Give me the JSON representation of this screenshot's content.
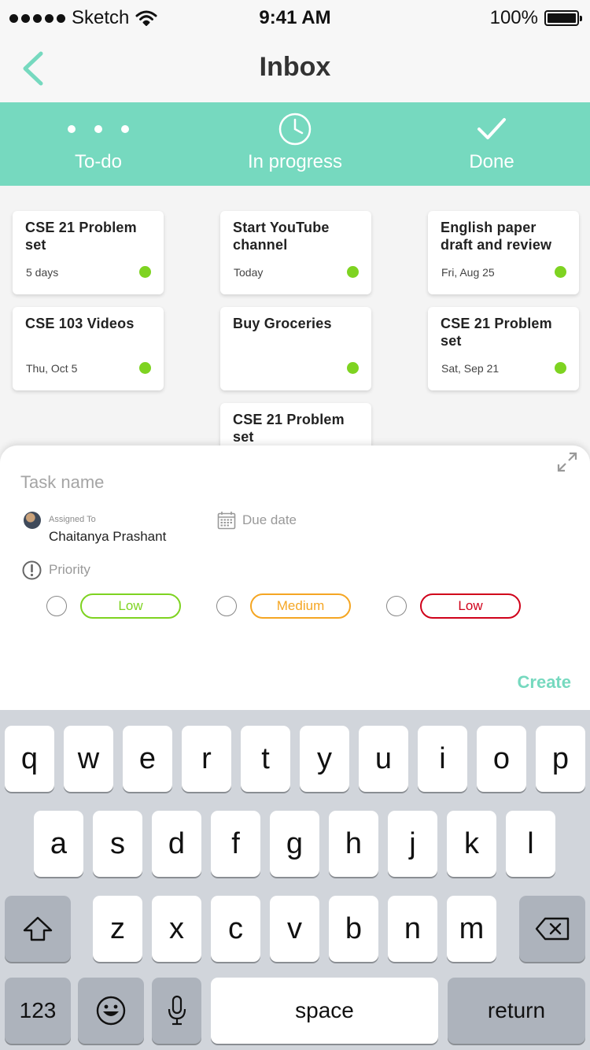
{
  "status_bar": {
    "carrier": "Sketch",
    "time": "9:41 AM",
    "battery": "100%"
  },
  "nav": {
    "title": "Inbox"
  },
  "tabs": [
    {
      "label": "To-do",
      "icon": "dots-icon"
    },
    {
      "label": "In progress",
      "icon": "clock-icon"
    },
    {
      "label": "Done",
      "icon": "checkmark-icon"
    }
  ],
  "columns": [
    {
      "cards": [
        {
          "title": "CSE 21 Problem set",
          "date": "5 days"
        },
        {
          "title": "CSE 103 Videos",
          "date": "Thu, Oct 5"
        }
      ]
    },
    {
      "cards": [
        {
          "title": "Start YouTube channel",
          "date": "Today"
        },
        {
          "title": "Buy Groceries",
          "date": ""
        },
        {
          "title": "CSE 21 Problem set",
          "date": ""
        }
      ]
    },
    {
      "cards": [
        {
          "title": "English paper draft and review",
          "date": "Fri, Aug 25"
        },
        {
          "title": "CSE 21 Problem set",
          "date": "Sat, Sep 21"
        }
      ]
    }
  ],
  "sheet": {
    "task_placeholder": "Task name",
    "assigned_label": "Assigned To",
    "assignee": "Chaitanya Prashant",
    "due_label": "Due date",
    "priority_label": "Priority",
    "priorities": [
      {
        "label": "Low",
        "color": "#7ed321"
      },
      {
        "label": "Medium",
        "color": "#f5a623"
      },
      {
        "label": "Low",
        "color": "#d0021b"
      }
    ],
    "create_label": "Create"
  },
  "colors": {
    "accent": "#76d9bf",
    "status_dot": "#7ed321"
  },
  "keyboard": {
    "row1": [
      "q",
      "w",
      "e",
      "r",
      "t",
      "y",
      "u",
      "i",
      "o",
      "p"
    ],
    "row2": [
      "a",
      "s",
      "d",
      "f",
      "g",
      "h",
      "j",
      "k",
      "l"
    ],
    "row3": [
      "z",
      "x",
      "c",
      "v",
      "b",
      "n",
      "m"
    ],
    "numbers": "123",
    "space": "space",
    "return": "return"
  }
}
